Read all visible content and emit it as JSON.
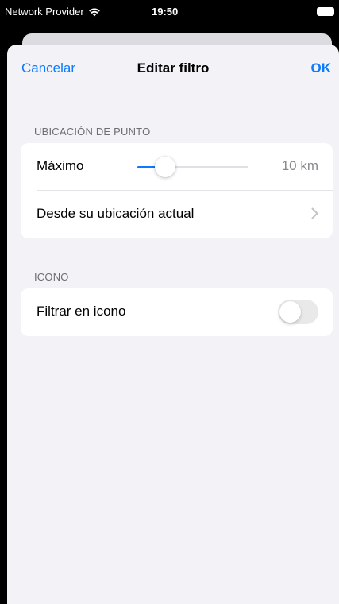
{
  "status_bar": {
    "carrier": "Network Provider",
    "time": "19:50",
    "wifi_icon": "wifi-icon",
    "battery_icon": "battery-icon"
  },
  "nav": {
    "cancel_label": "Cancelar",
    "title": "Editar filtro",
    "ok_label": "OK"
  },
  "sections": {
    "location": {
      "header": "UBICACIÓN DE PUNTO",
      "max_label": "Máximo",
      "max_value": "10 km",
      "slider_fraction": 0.25,
      "from_location_label": "Desde su ubicación actual",
      "chevron_icon": "chevron-right-icon"
    },
    "icon": {
      "header": "ICONO",
      "filter_label": "Filtrar en icono",
      "filter_on": false
    }
  },
  "colors": {
    "accent": "#0a7aff",
    "background": "#f2f2f7",
    "secondary_text": "#8a8a8e",
    "toggle_off": "#e9e9ea"
  }
}
